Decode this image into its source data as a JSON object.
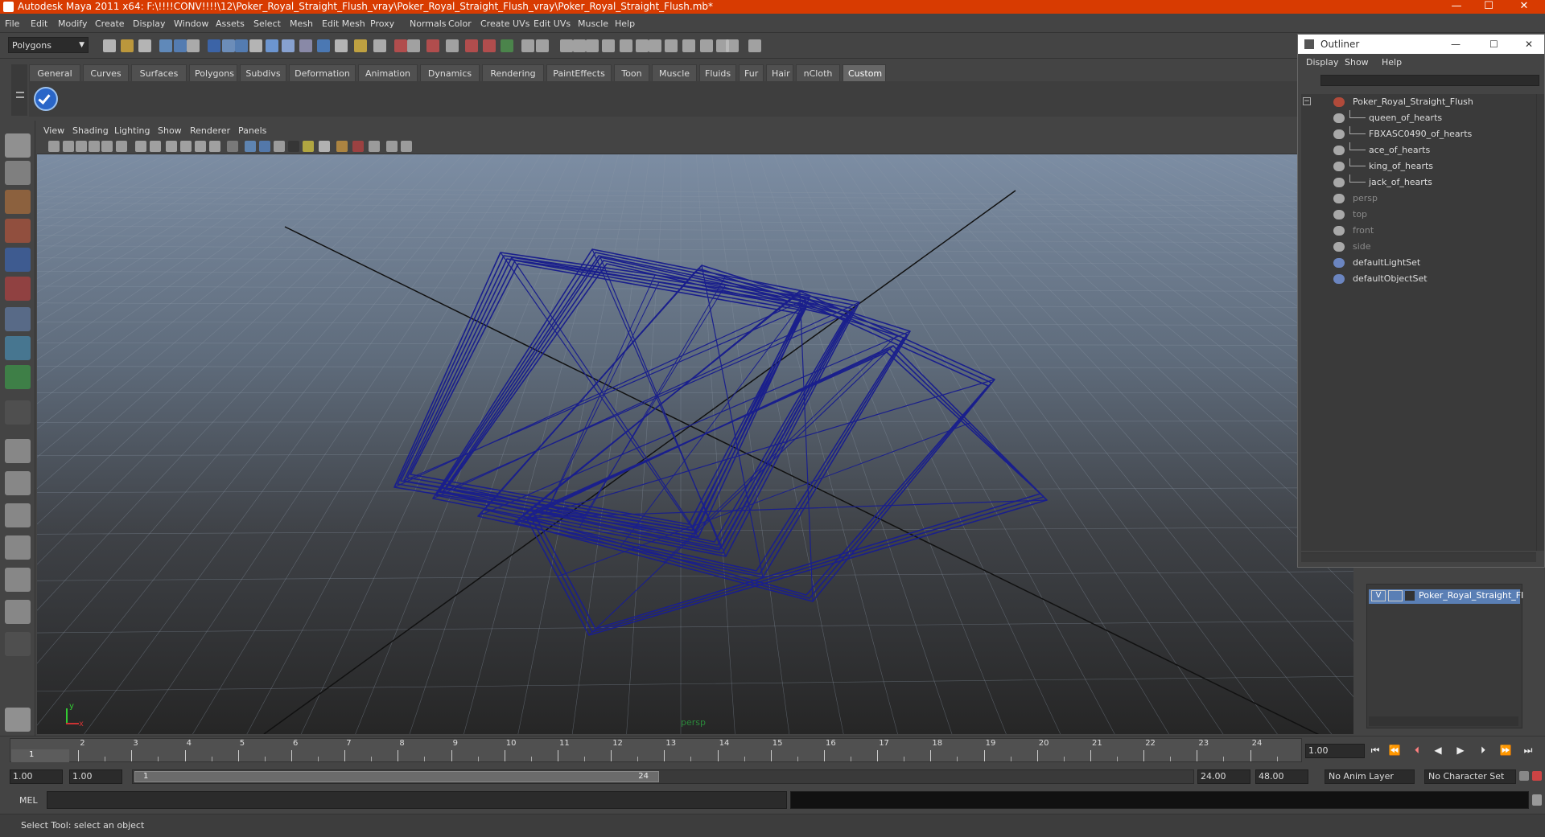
{
  "window": {
    "title": "Autodesk Maya 2011 x64: F:\\!!!!CONV!!!!\\12\\Poker_Royal_Straight_Flush_vray\\Poker_Royal_Straight_Flush_vray\\Poker_Royal_Straight_Flush.mb*",
    "accent": "#d83b01",
    "minimize": "—",
    "maximize": "☐",
    "close": "✕"
  },
  "menubar": [
    "File",
    "Edit",
    "Modify",
    "Create",
    "Display",
    "Window",
    "Assets",
    "Select",
    "Mesh",
    "Edit Mesh",
    "Proxy",
    "Normals",
    "Color",
    "Create UVs",
    "Edit UVs",
    "Muscle",
    "Help"
  ],
  "statusline": {
    "mode": "Polygons"
  },
  "shelf": {
    "tabs": [
      "General",
      "Curves",
      "Surfaces",
      "Polygons",
      "Subdivs",
      "Deformation",
      "Animation",
      "Dynamics",
      "Rendering",
      "PaintEffects",
      "Toon",
      "Muscle",
      "Fluids",
      "Fur",
      "Hair",
      "nCloth",
      "Custom"
    ],
    "active": "Custom"
  },
  "viewport": {
    "menu": [
      "View",
      "Shading",
      "Lighting",
      "Show",
      "Renderer",
      "Panels"
    ],
    "camera_label": "persp",
    "axis_y": "y",
    "axis_x": "x",
    "wire_color": "#1a1f8c"
  },
  "outliner": {
    "title": "Outliner",
    "menu": [
      "Display",
      "Show",
      "Help"
    ],
    "items": [
      {
        "label": "Poker_Royal_Straight_Flush",
        "indent": 0,
        "dim": false
      },
      {
        "label": "queen_of_hearts",
        "indent": 1,
        "dim": false
      },
      {
        "label": "FBXASC0490_of_hearts",
        "indent": 1,
        "dim": false
      },
      {
        "label": "ace_of_hearts",
        "indent": 1,
        "dim": false
      },
      {
        "label": "king_of_hearts",
        "indent": 1,
        "dim": false
      },
      {
        "label": "jack_of_hearts",
        "indent": 1,
        "dim": false
      },
      {
        "label": "persp",
        "indent": 0,
        "dim": true
      },
      {
        "label": "top",
        "indent": 0,
        "dim": true
      },
      {
        "label": "front",
        "indent": 0,
        "dim": true
      },
      {
        "label": "side",
        "indent": 0,
        "dim": true
      },
      {
        "label": "defaultLightSet",
        "indent": 0,
        "dim": false
      },
      {
        "label": "defaultObjectSet",
        "indent": 0,
        "dim": false
      }
    ]
  },
  "layer": {
    "visible": "V",
    "name": "Poker_Royal_Straight_Fl"
  },
  "timeline": {
    "ticks": [
      "1",
      "2",
      "3",
      "4",
      "5",
      "6",
      "7",
      "8",
      "9",
      "10",
      "11",
      "12",
      "13",
      "14",
      "15",
      "16",
      "17",
      "18",
      "19",
      "20",
      "21",
      "22",
      "23",
      "24"
    ],
    "current_frame_marker": "1",
    "current_time": "1.00"
  },
  "range": {
    "start": "1.00",
    "playback_start": "1.00",
    "slider_start": "1",
    "slider_end": "24",
    "playback_end": "24.00",
    "end": "48.00",
    "anim_layer": "No Anim Layer",
    "character_set": "No Character Set"
  },
  "command": {
    "label": "MEL"
  },
  "help": {
    "text": "Select Tool: select an object"
  }
}
